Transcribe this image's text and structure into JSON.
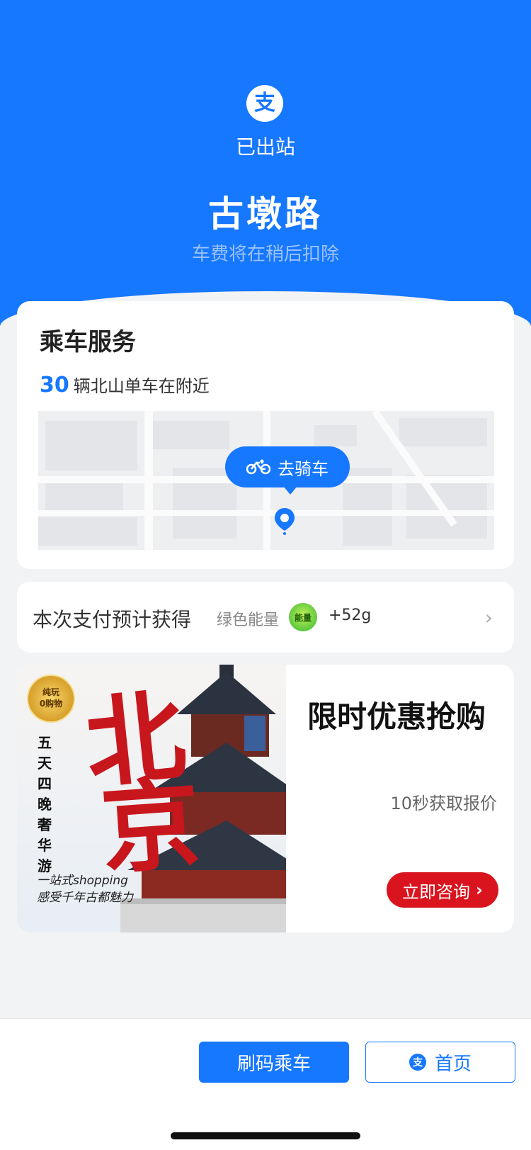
{
  "header": {
    "logo_char": "支",
    "status": "已出站",
    "station": "古墩路",
    "fee_note": "车费将在稍后扣除"
  },
  "ride_service": {
    "title": "乘车服务",
    "bike_count": "30",
    "bike_text": "辆北山单车在附近",
    "go_ride_label": "去骑车"
  },
  "energy": {
    "label": "本次支付预计获得",
    "type": "绿色能量",
    "badge": "能量",
    "amount": "+52g"
  },
  "ad": {
    "image_title_1": "北",
    "image_title_2": "京",
    "medal_line1": "纯玩",
    "medal_line2": "0购物",
    "vertical_text": [
      "五",
      "天",
      "四",
      "晚",
      "奢",
      "华",
      "游"
    ],
    "sub1": "一站式shopping",
    "sub2": "感受千年古都魅力",
    "headline": "限时优惠抢购",
    "quote": "10秒获取报价",
    "consult_label": "立即咨询"
  },
  "bottom_bar": {
    "scan_label": "刷码乘车",
    "home_label": "首页"
  },
  "colors": {
    "primary": "#1677ff",
    "ad_red": "#d9141e",
    "energy_green": "#5ac83c"
  }
}
